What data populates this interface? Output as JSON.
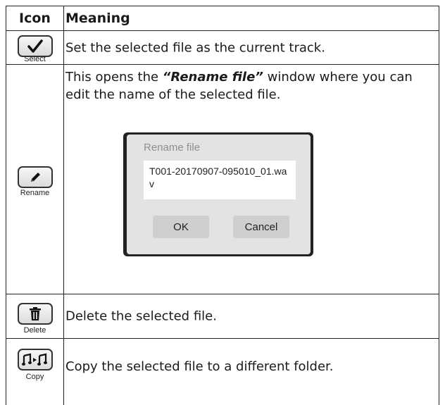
{
  "table": {
    "header_icon": "Icon",
    "header_meaning": "Meaning"
  },
  "rows": [
    {
      "icon_name": "checkmark-icon",
      "icon_label": "Select",
      "meaning": "Set the selected file as the current track."
    },
    {
      "icon_name": "pencil-icon",
      "icon_label": "Rename",
      "meaning_before": "This opens the ",
      "meaning_emph": "“Rename file”",
      "meaning_after": " window where you can edit the name of the selected file."
    },
    {
      "icon_name": "trash-icon",
      "icon_label": "Delete",
      "meaning": "Delete the selected file."
    },
    {
      "icon_name": "music-copy-icon",
      "icon_label": "Copy",
      "meaning": "Copy the selected file to a different folder."
    }
  ],
  "rename_dialog": {
    "title": "Rename file",
    "filename": "T001-20170907-095010_01.wav",
    "ok_label": "OK",
    "cancel_label": "Cancel"
  }
}
